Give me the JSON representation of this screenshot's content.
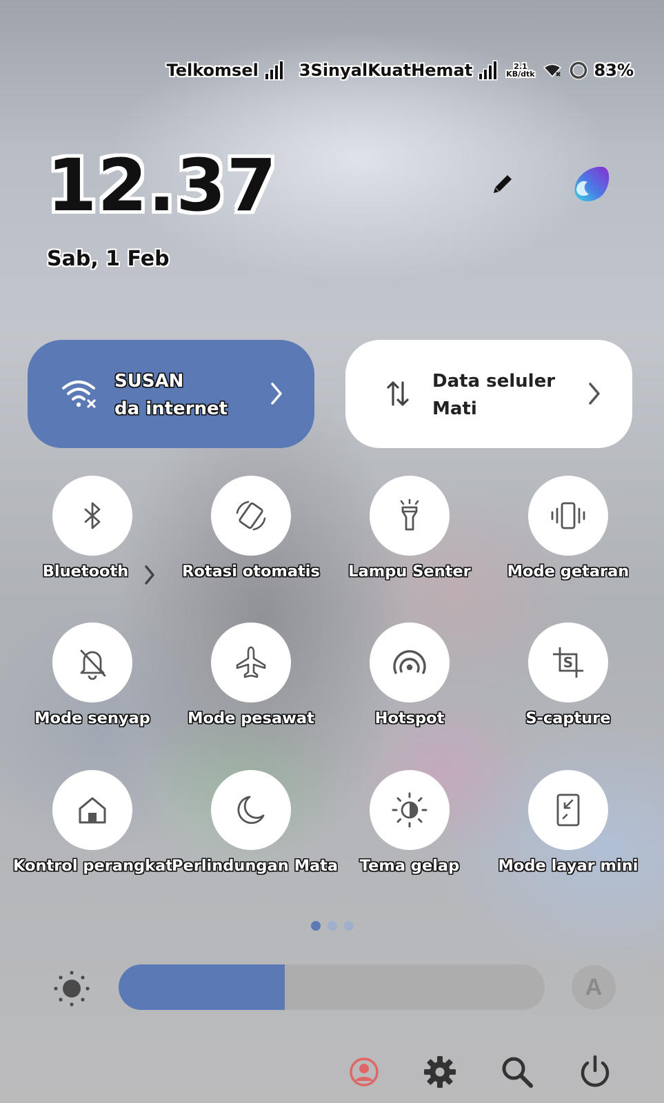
{
  "status_bar": {
    "carrier1": "Telkomsel",
    "carrier2": "3SinyalKuatHemat",
    "net_speed_value": "2.1",
    "net_speed_unit": "KB/dtk",
    "battery": "83%"
  },
  "clock": {
    "time": "12.37",
    "date": "Sab, 1 Feb"
  },
  "wifi_tile": {
    "title": "SUSAN",
    "subtitle": "da internet",
    "icon": "wifi-no-internet-icon"
  },
  "data_tile": {
    "title": "Data seluler",
    "subtitle": "Mati",
    "icon": "mobile-data-arrows-icon"
  },
  "toggles": [
    {
      "label": "Bluetooth",
      "icon": "bluetooth-icon"
    },
    {
      "label": "Rotasi otomatis",
      "icon": "auto-rotate-icon"
    },
    {
      "label": "Lampu Senter",
      "icon": "flashlight-icon"
    },
    {
      "label": "Mode getaran",
      "icon": "vibrate-icon"
    },
    {
      "label": "Mode senyap",
      "icon": "silent-bell-icon"
    },
    {
      "label": "Mode pesawat",
      "icon": "airplane-icon"
    },
    {
      "label": "Hotspot",
      "icon": "hotspot-icon"
    },
    {
      "label": "S-capture",
      "icon": "screenshot-icon"
    },
    {
      "label": "Kontrol perangkat",
      "icon": "home-icon"
    },
    {
      "label": "Perlindungan Mata",
      "icon": "moon-icon"
    },
    {
      "label": "Tema gelap",
      "icon": "dark-theme-icon"
    },
    {
      "label": "Mode layar mini",
      "icon": "mini-window-icon"
    }
  ],
  "pager": {
    "pages": 3,
    "active": 0
  },
  "brightness": {
    "level_fraction": 0.39,
    "auto_label": "A"
  },
  "colors": {
    "accent": "#5b79b5",
    "account_icon": "#e06666"
  }
}
